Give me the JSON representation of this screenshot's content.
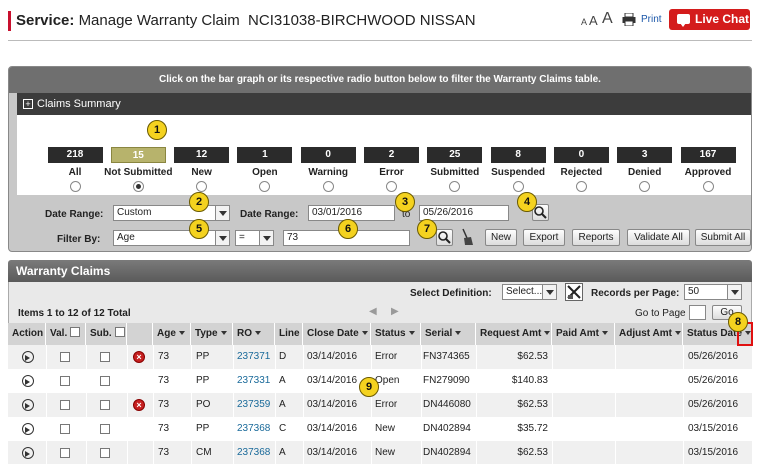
{
  "header": {
    "section": "Service",
    "title": "Manage Warranty Claim  NCI31038-BIRCHWOOD NISSAN",
    "font_sizes": [
      "A",
      "A",
      "A"
    ],
    "print_label": "Print",
    "chat_label": "Live Chat"
  },
  "summary": {
    "instruction": "Click on the bar graph or its respective radio button below to filter the Warranty Claims table.",
    "title": "Claims Summary",
    "selected": "Not Submitted",
    "categories": [
      {
        "label": "All",
        "count": "218"
      },
      {
        "label": "Not Submitted",
        "count": "15"
      },
      {
        "label": "New",
        "count": "12"
      },
      {
        "label": "Open",
        "count": "1"
      },
      {
        "label": "Warning",
        "count": "0"
      },
      {
        "label": "Error",
        "count": "2"
      },
      {
        "label": "Submitted",
        "count": "25"
      },
      {
        "label": "Suspended",
        "count": "8"
      },
      {
        "label": "Rejected",
        "count": "0"
      },
      {
        "label": "Denied",
        "count": "3"
      },
      {
        "label": "Approved",
        "count": "167"
      }
    ]
  },
  "filters": {
    "date_range_label": "Date Range:",
    "date_range_value": "Custom",
    "date_range2_label": "Date Range:",
    "date_from": "03/01/2016",
    "to_label": "to",
    "date_to": "05/26/2016",
    "filter_by_label": "Filter By:",
    "filter_field": "Age",
    "filter_op": "=",
    "filter_value": "73",
    "buttons": {
      "new": "New",
      "export": "Export",
      "reports": "Reports",
      "validate_all": "Validate All",
      "submit_all": "Submit All"
    }
  },
  "claims": {
    "title": "Warranty Claims",
    "select_definition_label": "Select Definition:",
    "select_definition_value": "Select...",
    "records_per_page_label": "Records per Page:",
    "records_per_page_value": "50",
    "items_text": "Items 1 to 12 of 12 Total",
    "go_to_page_label": "Go to Page",
    "go_label": "Go",
    "columns": {
      "action": "Action",
      "val": "Val.",
      "sub": "Sub.",
      "age": "Age",
      "type": "Type",
      "ro": "RO",
      "line": "Line",
      "close_date": "Close Date",
      "status": "Status",
      "serial": "Serial",
      "request_amt": "Request Amt",
      "paid_amt": "Paid Amt",
      "adjust_amt": "Adjust Amt",
      "status_date": "Status Date"
    },
    "rows": [
      {
        "error": true,
        "age": "73",
        "type": "PP",
        "ro": "237371",
        "line": "D",
        "close_date": "03/14/2016",
        "status": "Error",
        "serial": "FN374365",
        "request_amt": "$62.53",
        "status_date": "05/26/2016"
      },
      {
        "error": false,
        "age": "73",
        "type": "PP",
        "ro": "237331",
        "line": "A",
        "close_date": "03/14/2016",
        "status": "Open",
        "serial": "FN279090",
        "request_amt": "$140.83",
        "status_date": "05/26/2016"
      },
      {
        "error": true,
        "age": "73",
        "type": "PO",
        "ro": "237359",
        "line": "A",
        "close_date": "03/14/2016",
        "status": "Error",
        "serial": "DN446080",
        "request_amt": "$62.53",
        "status_date": "05/26/2016"
      },
      {
        "error": false,
        "age": "73",
        "type": "PP",
        "ro": "237368",
        "line": "C",
        "close_date": "03/14/2016",
        "status": "New",
        "serial": "DN402894",
        "request_amt": "$35.72",
        "status_date": "03/15/2016"
      },
      {
        "error": false,
        "age": "73",
        "type": "CM",
        "ro": "237368",
        "line": "A",
        "close_date": "03/14/2016",
        "status": "New",
        "serial": "DN402894",
        "request_amt": "$62.53",
        "status_date": "03/15/2016"
      }
    ]
  },
  "callouts": [
    "1",
    "2",
    "3",
    "4",
    "5",
    "6",
    "7",
    "8",
    "9"
  ]
}
